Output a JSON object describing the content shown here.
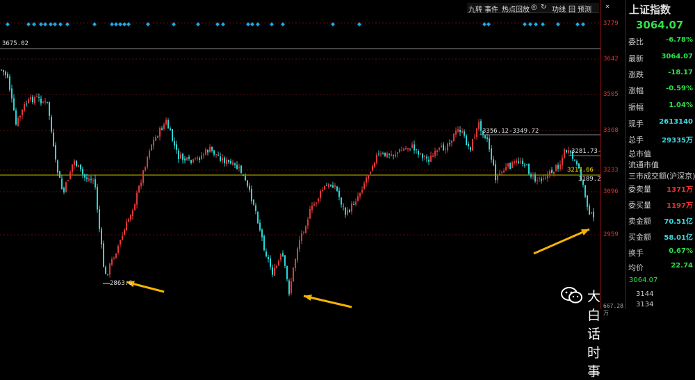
{
  "toolbar": {
    "items": [
      "九转",
      "事件",
      "热点回放",
      "◎",
      "↻",
      "功线",
      "回",
      "预测"
    ],
    "highlight_close_label": "✕"
  },
  "axis": {
    "ticks": [
      "3779",
      "3642",
      "3505",
      "3368",
      "3233",
      "3096",
      "2959"
    ],
    "bottom_partial": "667.28万"
  },
  "annotations": {
    "top_value": "3675.02",
    "range_1": "3356.12-3349.72",
    "range_2": "3281.73-",
    "level_1": "3217.66",
    "level_2": "3189.2",
    "low_value": "2863.6"
  },
  "panel": {
    "title": "上证指数",
    "price": "3064.07",
    "rows": [
      {
        "label": "委比",
        "value": "-6.78%",
        "color": "green"
      },
      {
        "label": "最新",
        "value": "3064.07",
        "color": "green"
      },
      {
        "label": "涨跌",
        "value": "-18.17",
        "color": "green"
      },
      {
        "label": "涨幅",
        "value": "-0.59%",
        "color": "green"
      },
      {
        "label": "振幅",
        "value": "1.04%",
        "color": "green"
      },
      {
        "label": "现手",
        "value": "2613140",
        "color": "cyan"
      },
      {
        "label": "总手",
        "value": "29335万",
        "color": "cyan"
      },
      {
        "label": "总市值",
        "value": "",
        "color": "cyan"
      },
      {
        "label": "流通市值",
        "value": "",
        "color": "cyan"
      },
      {
        "label": "三市成交额(沪深京)",
        "value": "",
        "color": "cyan"
      },
      {
        "label": "委卖量",
        "value": "1371万",
        "color": "red"
      },
      {
        "label": "委买量",
        "value": "1197万",
        "color": "red"
      },
      {
        "label": "卖金额",
        "value": "70.51亿",
        "color": "cyan"
      },
      {
        "label": "买金额",
        "value": "58.01亿",
        "color": "cyan"
      },
      {
        "label": "换手",
        "value": "0.67%",
        "color": "green"
      },
      {
        "label": "均价",
        "value": "22.74",
        "color": "green"
      }
    ],
    "extra_values": [
      "3064.07",
      "3144",
      "3134"
    ]
  },
  "watermark": {
    "text": "大白话时事"
  },
  "colors": {
    "up": "#e03838",
    "down": "#2ad6d6",
    "ma": "#c8c000",
    "marker": "#1ca8e8",
    "arrow": "#f5b400"
  }
}
